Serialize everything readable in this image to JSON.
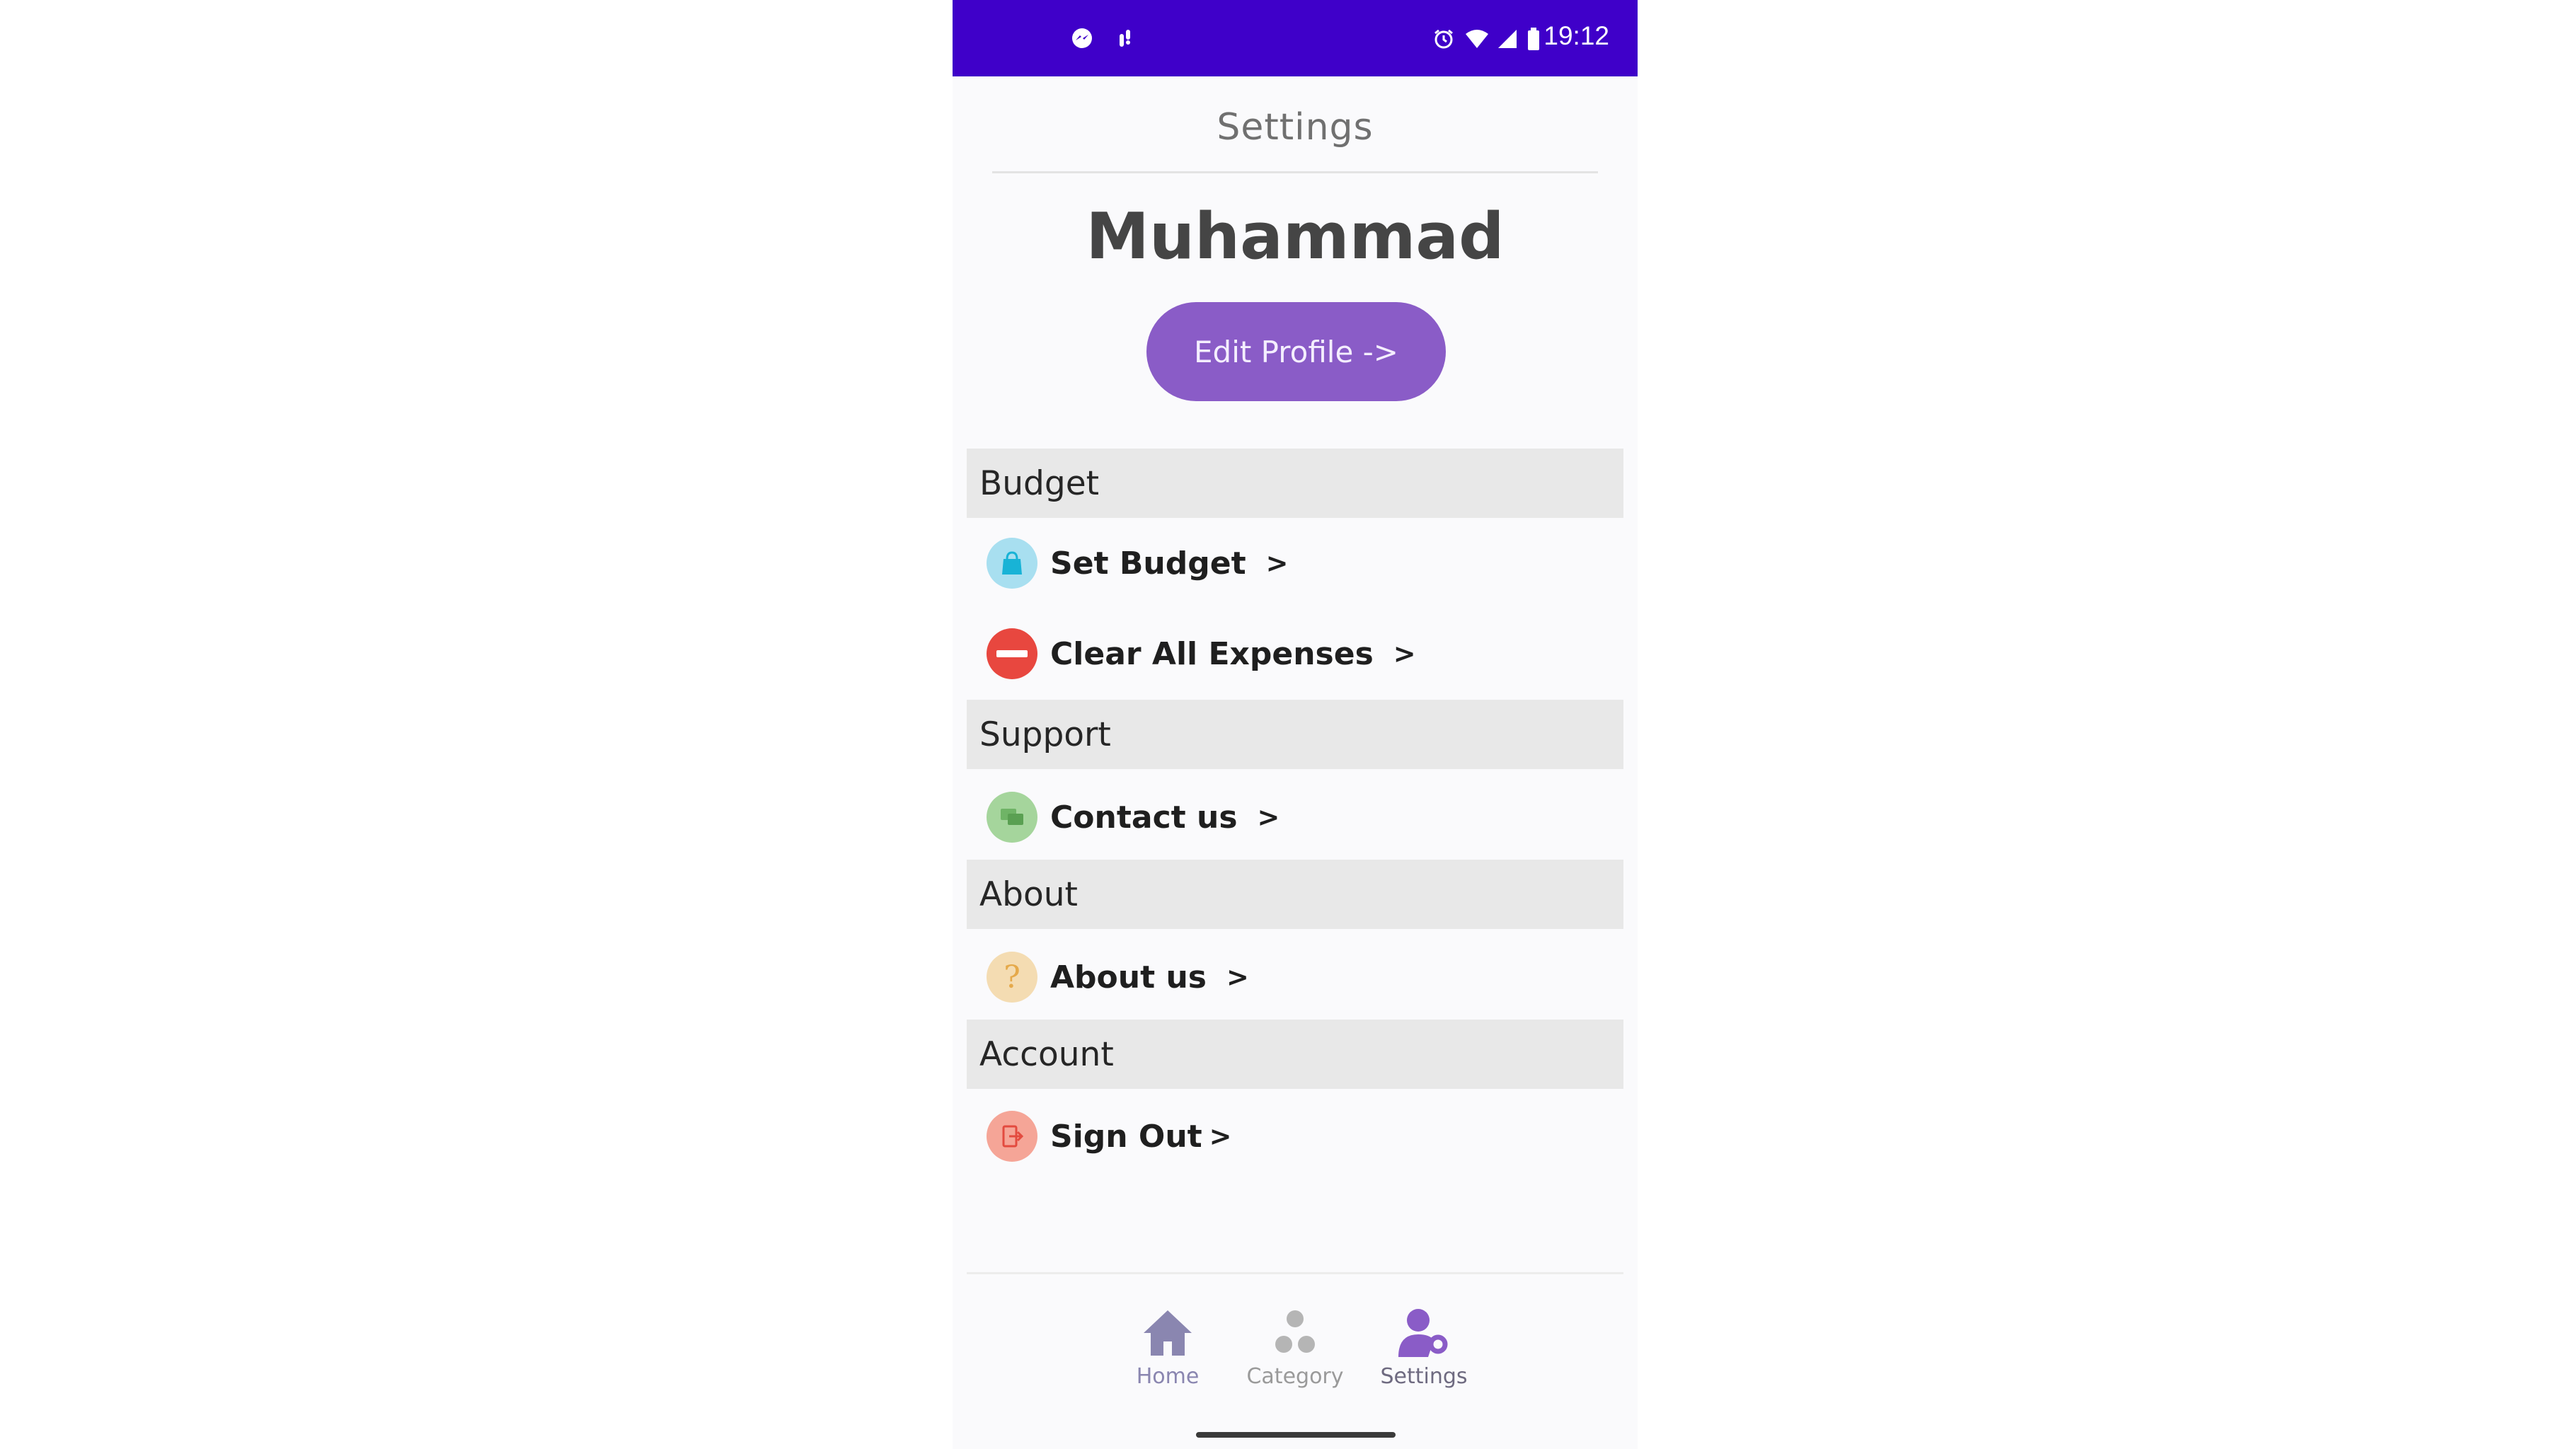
{
  "status_bar": {
    "time": "19:12",
    "left_icons": [
      "messenger-icon",
      "pointer-notification-icon"
    ],
    "right_icons": [
      "alarm-icon",
      "wifi-icon",
      "signal-icon",
      "battery-icon"
    ],
    "color": "#3f00c9"
  },
  "header": {
    "title": "Settings"
  },
  "profile": {
    "name": "Muhammad",
    "edit_button": "Edit Profile ->"
  },
  "sections": {
    "budget": {
      "title": "Budget",
      "items": [
        {
          "label": "Set Budget",
          "icon": "shopping-bag-icon"
        },
        {
          "label": "Clear All Expenses",
          "icon": "minus-circle-icon"
        }
      ]
    },
    "support": {
      "title": "Support",
      "items": [
        {
          "label": "Contact us",
          "icon": "chat-bubbles-icon"
        }
      ]
    },
    "about": {
      "title": "About",
      "items": [
        {
          "label": "About us",
          "icon": "question-icon"
        }
      ]
    },
    "account": {
      "title": "Account",
      "items": [
        {
          "label": "Sign Out",
          "icon": "sign-out-icon"
        }
      ]
    }
  },
  "chevron": ">",
  "bottom_nav": {
    "items": [
      {
        "label": "Home",
        "icon": "home-icon"
      },
      {
        "label": "Category",
        "icon": "category-dots-icon"
      },
      {
        "label": "Settings",
        "icon": "user-settings-icon",
        "active": true
      }
    ]
  },
  "colors": {
    "accent": "#8a5cc7",
    "nav_active": "#8a5cc7",
    "nav_inactive": "#9a9a9a"
  }
}
